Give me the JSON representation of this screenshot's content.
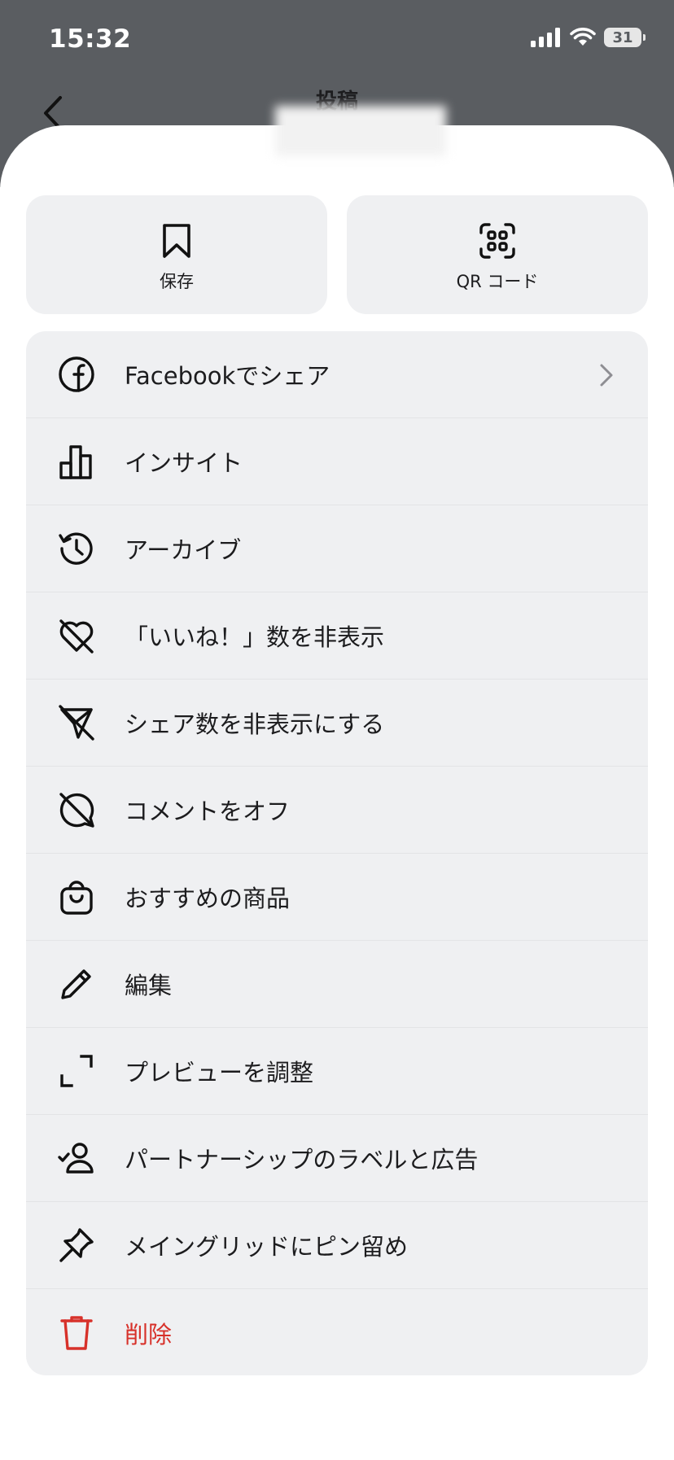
{
  "status_bar": {
    "time": "15:32",
    "battery": "31",
    "icons": [
      "signal-icon",
      "wifi-icon",
      "battery-icon"
    ]
  },
  "header": {
    "title": "投稿",
    "back_icon": "chevron-left-icon"
  },
  "quick_actions": [
    {
      "label": "保存",
      "icon": "bookmark-icon"
    },
    {
      "label": "QR コード",
      "icon": "qr-code-icon"
    }
  ],
  "menu": {
    "items": [
      {
        "label": "Facebookでシェア",
        "icon": "facebook-icon",
        "has_chevron": true
      },
      {
        "label": "インサイト",
        "icon": "insights-bar-chart-icon"
      },
      {
        "label": "アーカイブ",
        "icon": "archive-history-icon"
      },
      {
        "label": "「いいね！」数を非表示",
        "icon": "heart-off-icon"
      },
      {
        "label": "シェア数を非表示にする",
        "icon": "share-off-icon"
      },
      {
        "label": "コメントをオフ",
        "icon": "comment-off-icon"
      },
      {
        "label": "おすすめの商品",
        "icon": "shopping-bag-icon"
      },
      {
        "label": "編集",
        "icon": "pencil-icon"
      },
      {
        "label": "プレビューを調整",
        "icon": "crop-frame-icon"
      },
      {
        "label": "パートナーシップのラベルと広告",
        "icon": "partnership-user-check-icon"
      },
      {
        "label": "メイングリッドにピン留め",
        "icon": "pin-icon"
      },
      {
        "label": "削除",
        "icon": "trash-icon",
        "danger": true
      }
    ]
  },
  "colors": {
    "header_bg": "#5a5d61",
    "sheet_bg": "#ffffff",
    "menu_bg": "#eff0f2",
    "text": "#1c1c1e",
    "danger": "#d7312a",
    "chevron": "#8e8e93"
  }
}
